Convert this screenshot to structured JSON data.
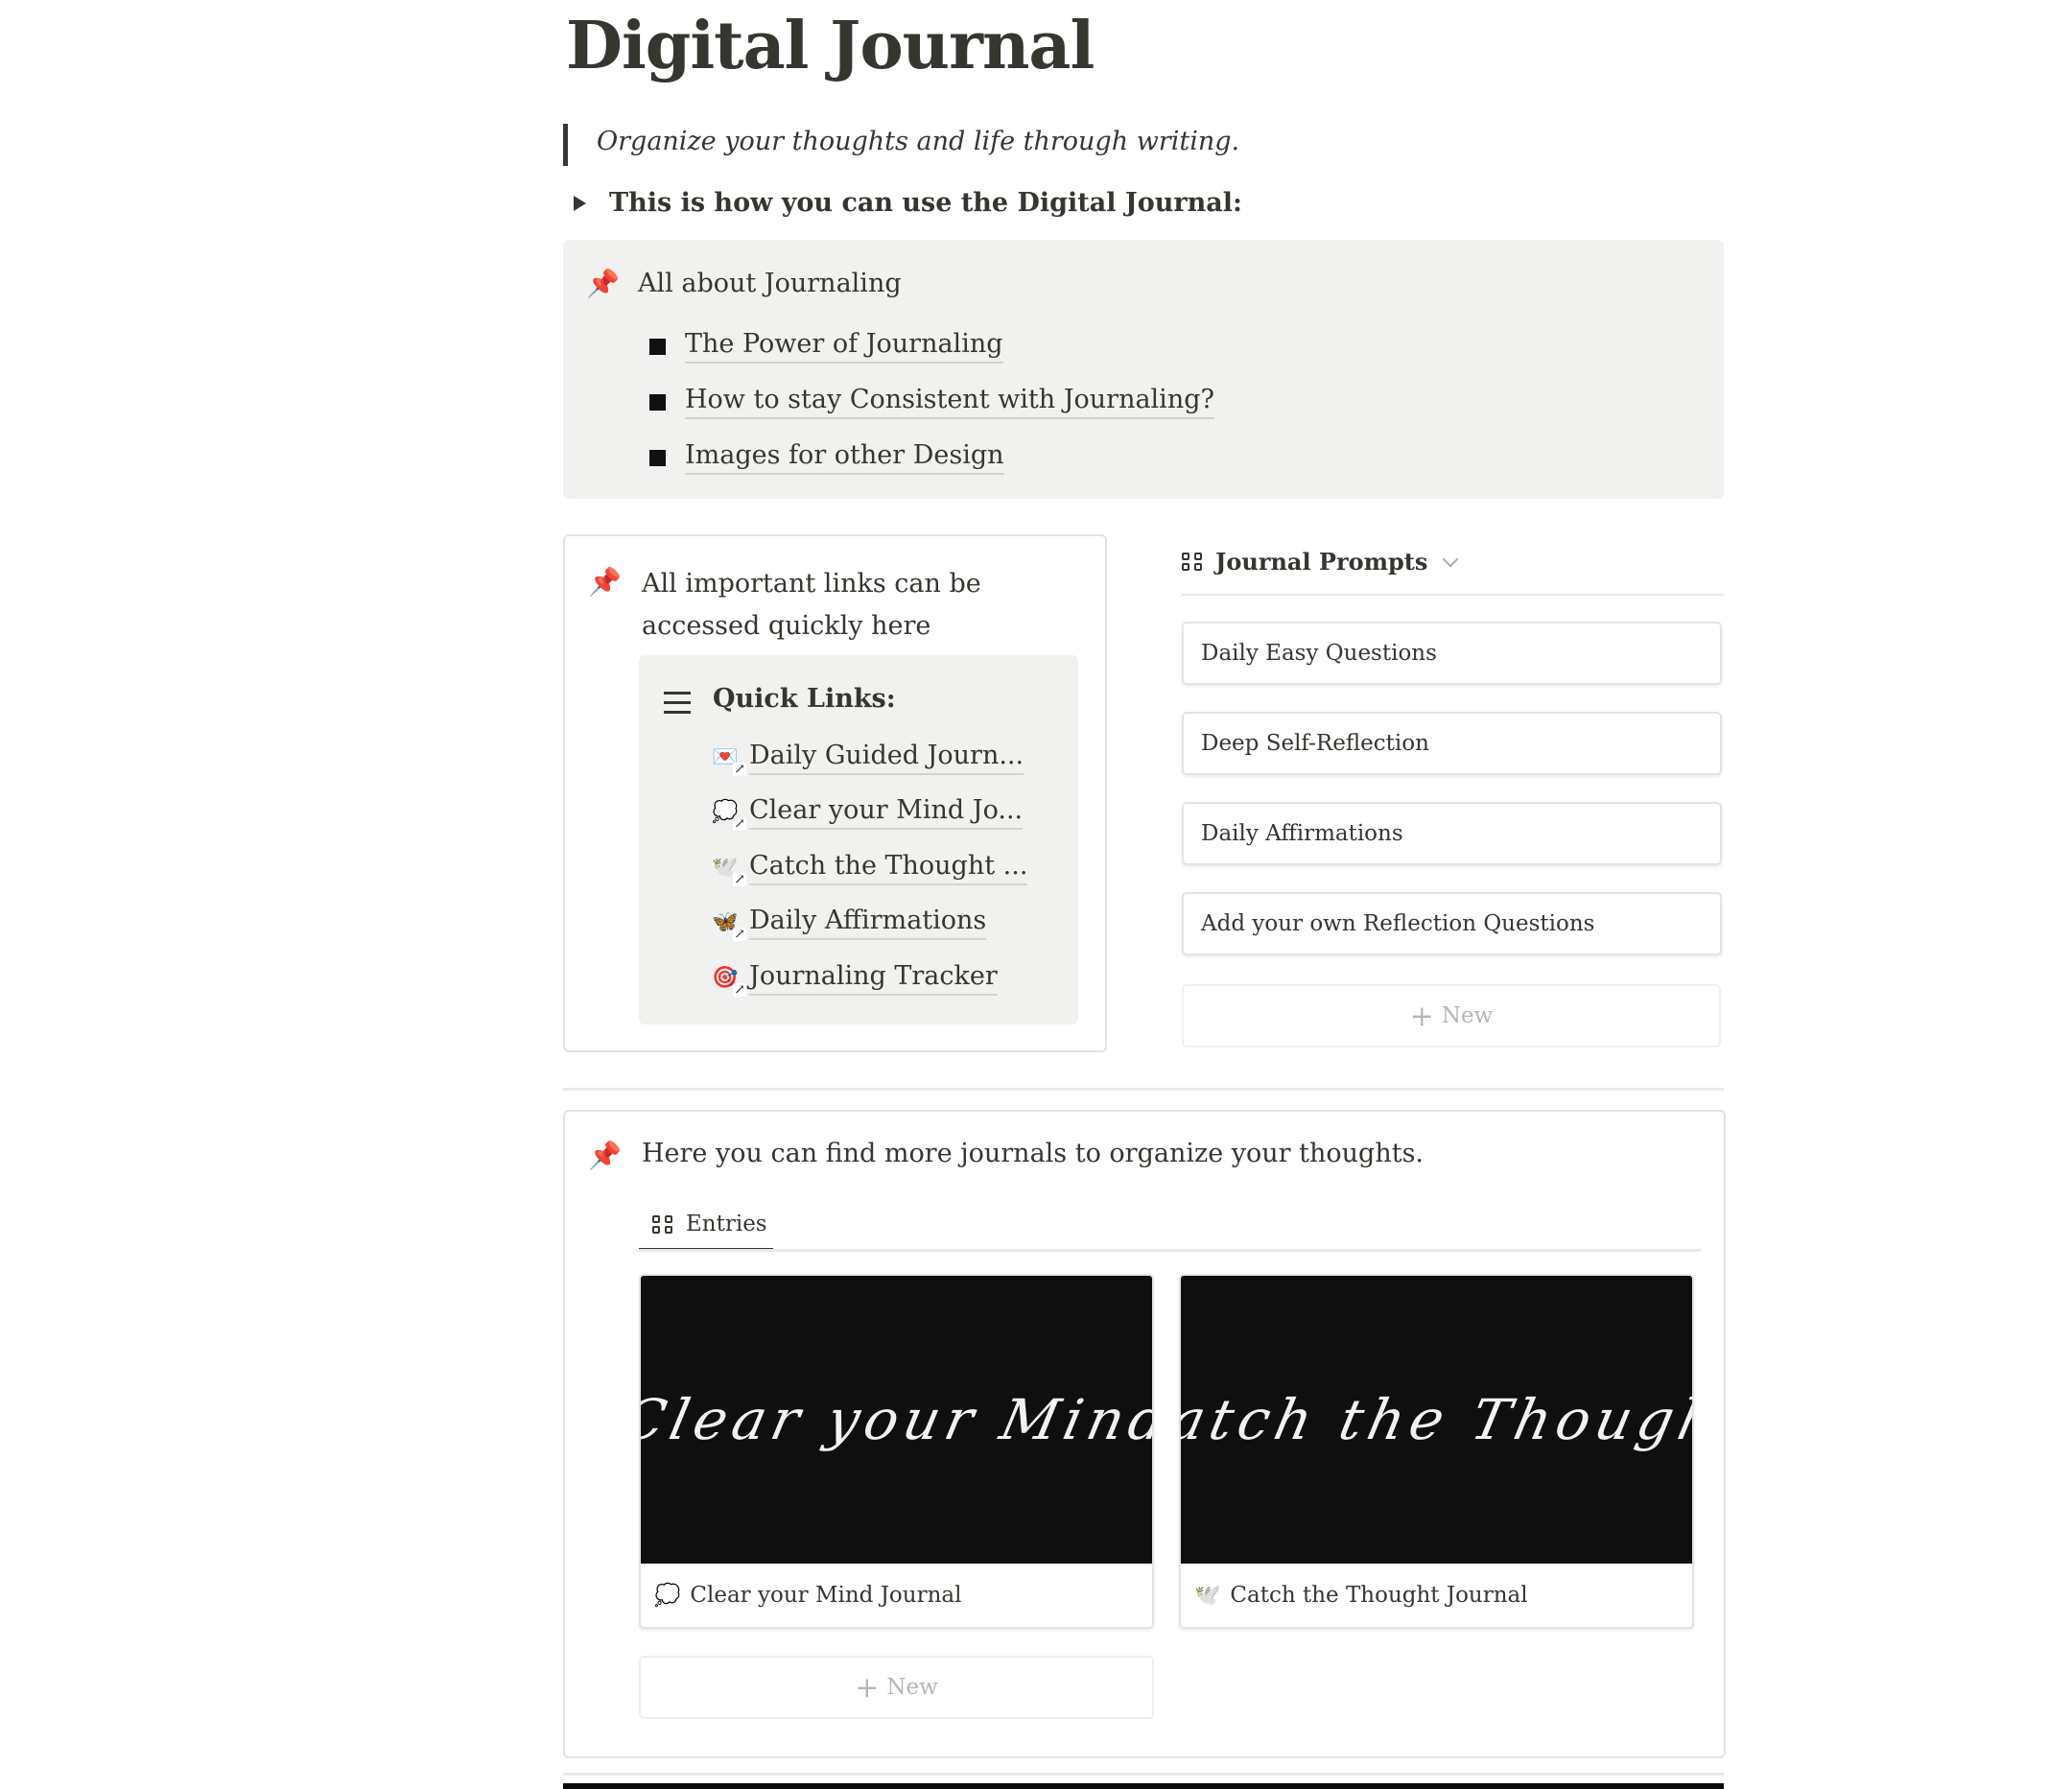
{
  "page": {
    "title": "Digital Journal",
    "quote": "Organize your thoughts and life through writing.",
    "toggle_label": "This is how you can use the Digital Journal:"
  },
  "callout_about": {
    "icon": "pushpin-icon",
    "heading": "All about Journaling",
    "items": [
      {
        "label": "The Power of Journaling"
      },
      {
        "label": "How to stay Consistent with Journaling?"
      },
      {
        "label": "Images for other Design"
      }
    ]
  },
  "links_box": {
    "icon": "pushpin-icon",
    "heading": "All important links can be accessed quickly here",
    "quick_links": {
      "title": "Quick Links:",
      "items": [
        {
          "emoji": "💌",
          "label": "Daily Guided Journ..."
        },
        {
          "emoji": "💭",
          "label": "Clear your Mind Jo..."
        },
        {
          "emoji": "🕊️",
          "label": "Catch the Thought ..."
        },
        {
          "emoji": "🦋",
          "label": "Daily Affirmations"
        },
        {
          "emoji": "🎯",
          "label": "Journaling Tracker"
        }
      ]
    }
  },
  "prompts": {
    "view_title": "Journal Prompts",
    "cards": [
      {
        "label": "Daily Easy Questions"
      },
      {
        "label": "Deep Self-Reflection"
      },
      {
        "label": "Daily Affirmations"
      },
      {
        "label": "Add your own Reflection Questions"
      }
    ],
    "new_label": "New"
  },
  "journals": {
    "icon": "pushpin-icon",
    "heading": "Here you can find more journals to organize your thoughts.",
    "tab_label": "Entries",
    "entries": [
      {
        "cover_text": "Clear your Mind",
        "emoji": "💭",
        "title": "Clear your Mind Journal"
      },
      {
        "cover_text": "Catch the Thought",
        "emoji": "🕊️",
        "title": "Catch the Thought Journal"
      }
    ],
    "new_label": "New"
  }
}
